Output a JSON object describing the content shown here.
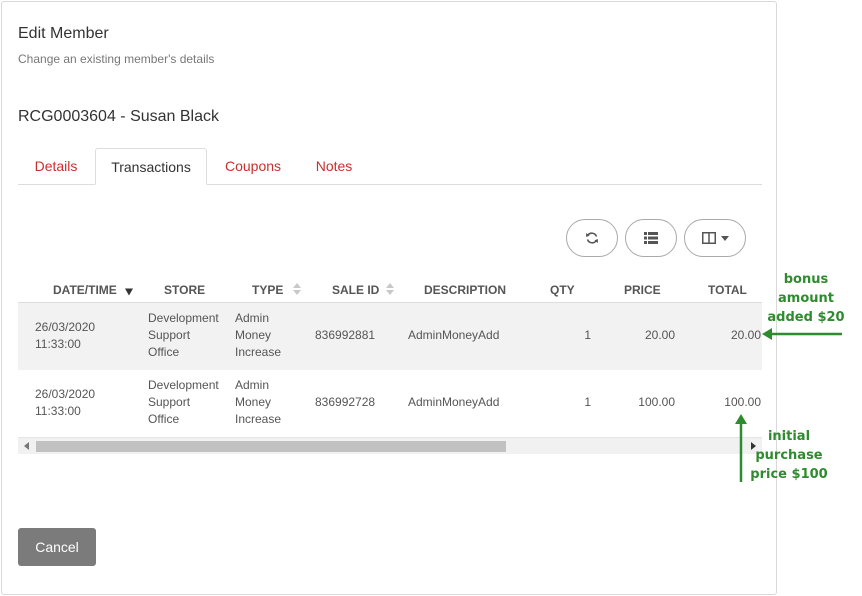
{
  "page": {
    "title": "Edit Member",
    "subtitle": "Change an existing member's details",
    "member_heading": "RCG0003604 - Susan Black"
  },
  "tabs": [
    {
      "label": "Details",
      "active": false
    },
    {
      "label": "Transactions",
      "active": true
    },
    {
      "label": "Coupons",
      "active": false
    },
    {
      "label": "Notes",
      "active": false
    }
  ],
  "toolbar": {
    "buttons": [
      {
        "icon": "refresh-icon"
      },
      {
        "icon": "list-icon"
      },
      {
        "icon": "columns-icon",
        "has_dropdown": true
      }
    ]
  },
  "table": {
    "columns": [
      "DATE/TIME",
      "STORE",
      "TYPE",
      "SALE ID",
      "DESCRIPTION",
      "QTY",
      "PRICE",
      "TOTAL"
    ],
    "rows": [
      {
        "date": "26/03/2020",
        "time": "11:33:00",
        "store": [
          "Development",
          "Support",
          "Office"
        ],
        "type": [
          "Admin",
          "Money",
          "Increase"
        ],
        "sale_id": "836992881",
        "description": "AdminMoneyAdd",
        "qty": "1",
        "price": "20.00",
        "total": "20.00"
      },
      {
        "date": "26/03/2020",
        "time": "11:33:00",
        "store": [
          "Development",
          "Support",
          "Office"
        ],
        "type": [
          "Admin",
          "Money",
          "Increase"
        ],
        "sale_id": "836992728",
        "description": "AdminMoneyAdd",
        "qty": "1",
        "price": "100.00",
        "total": "100.00"
      }
    ]
  },
  "footer": {
    "cancel_label": "Cancel"
  },
  "annotations": {
    "bonus": [
      "bonus",
      "amount",
      "added $20"
    ],
    "initial": [
      "initial",
      "purchase",
      "price $100"
    ],
    "color": "#2e8b2e"
  },
  "colors": {
    "accent": "#c9302c",
    "cancel_bg": "#7b7b7b",
    "row_stripe": "#f2f2f2"
  }
}
